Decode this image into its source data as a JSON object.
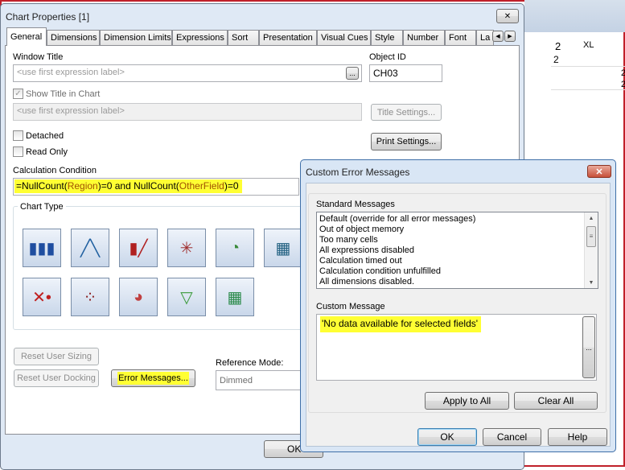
{
  "main_dialog": {
    "title": "Chart Properties [1]",
    "tabs": [
      "General",
      "Dimensions",
      "Dimension Limits",
      "Expressions",
      "Sort",
      "Presentation",
      "Visual Cues",
      "Style",
      "Number",
      "Font",
      "La"
    ],
    "active_tab": "General",
    "window_title_label": "Window Title",
    "window_title_placeholder": "<use first expression label>",
    "object_id_label": "Object ID",
    "object_id_value": "CH03",
    "show_title_label": "Show Title in Chart",
    "show_title_checked": true,
    "title_placeholder": "<use first expression label>",
    "title_settings": "Title Settings...",
    "detached_label": "Detached",
    "read_only_label": "Read Only",
    "print_settings": "Print Settings...",
    "calc_condition_label": "Calculation Condition",
    "calc_condition": {
      "p1": "=NullCount(",
      "f1": "Region",
      "p2": ")=0 and NullCount(",
      "f2": "OtherField",
      "p3": ")=0"
    },
    "chart_type_label": "Chart Type",
    "chart_types": [
      "bar-chart",
      "line-chart",
      "combo-chart",
      "radar-chart",
      "gauge-chart",
      "mekko-chart",
      "scatter-chart",
      "grid-chart",
      "pie-chart",
      "funnel-chart",
      "block-chart"
    ],
    "reset_user_sizing": "Reset User Sizing",
    "reset_user_docking": "Reset User Docking",
    "error_messages": "Error Messages...",
    "reference_mode_label": "Reference Mode:",
    "reference_mode_value": "Dimmed",
    "ok": "OK",
    "ellipsis": "..."
  },
  "background": {
    "value1": "2",
    "value2": "2",
    "xl": "XL",
    "cell1": "2",
    "cell2": "2"
  },
  "error_dialog": {
    "title": "Custom Error Messages",
    "standard_label": "Standard Messages",
    "standard_messages": [
      "Default (override for all error messages)",
      "Out of object memory",
      "Too many cells",
      "All expressions disabled",
      "Calculation timed out",
      "Calculation condition unfulfilled",
      "All dimensions disabled."
    ],
    "custom_label": "Custom Message",
    "custom_message": "'No data available for selected fields'",
    "ellipsis": "...",
    "apply_to_all": "Apply to All",
    "clear_all": "Clear All",
    "ok": "OK",
    "cancel": "Cancel",
    "help": "Help"
  },
  "colors": {
    "highlight": "#ffff33",
    "field": "#a05000",
    "frame": "#c0202a"
  }
}
